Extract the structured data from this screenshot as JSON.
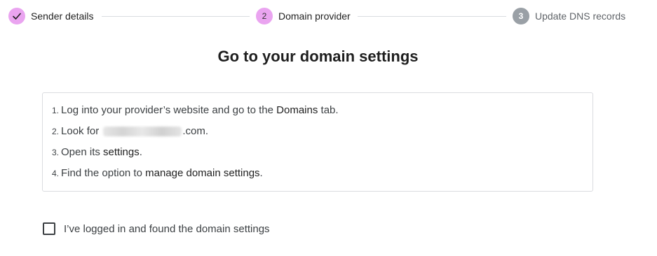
{
  "stepper": {
    "steps": [
      {
        "number": "✓",
        "label": "Sender details",
        "state": "completed"
      },
      {
        "number": "2",
        "label": "Domain provider",
        "state": "active"
      },
      {
        "number": "3",
        "label": "Update DNS records",
        "state": "upcoming"
      }
    ]
  },
  "page": {
    "title": "Go to your domain settings"
  },
  "instructions": {
    "items": [
      {
        "num": "1.",
        "text_before": "Log into your provider’s website and go to the ",
        "strong": "Domains",
        "text_after": " tab."
      },
      {
        "num": "2.",
        "text_before": "Look for ",
        "redacted": true,
        "text_after": ".com."
      },
      {
        "num": "3.",
        "text_before": "Open its ",
        "strong": "settings",
        "text_after": "."
      },
      {
        "num": "4.",
        "text_before": "Find the option to ",
        "strong": "manage domain settings",
        "text_after": "."
      }
    ]
  },
  "confirm": {
    "label": "I’ve logged in and found the domain settings",
    "checked": false
  },
  "colors": {
    "step_active": "#eaa4f0",
    "step_upcoming": "#9aa0a6",
    "border": "#dadce0"
  }
}
